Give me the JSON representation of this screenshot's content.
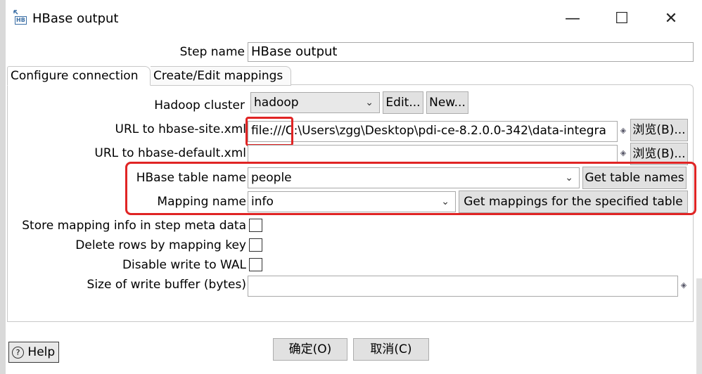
{
  "window": {
    "title": "HBase output",
    "icon_text": "HB",
    "minimize_glyph": "—",
    "maximize_glyph": "☐",
    "close_glyph": "✕"
  },
  "step": {
    "label": "Step name",
    "value": "HBase output"
  },
  "tabs": [
    {
      "label": "Configure connection",
      "active": true
    },
    {
      "label": "Create/Edit mappings",
      "active": false
    }
  ],
  "form": {
    "hadoop_cluster": {
      "label": "Hadoop cluster",
      "value": "hadoop",
      "edit_label": "Edit...",
      "new_label": "New..."
    },
    "hbase_site": {
      "label": "URL to hbase-site.xml",
      "value": "file:///C:\\Users\\zgg\\Desktop\\pdi-ce-8.2.0.0-342\\data-integra",
      "browse_label": "浏览(B)..."
    },
    "hbase_default": {
      "label": "URL to hbase-default.xml",
      "value": "",
      "browse_label": "浏览(B)..."
    },
    "table_name": {
      "label": "HBase table name",
      "value": "people",
      "button_label": "Get table names"
    },
    "mapping_name": {
      "label": "Mapping name",
      "value": "info",
      "button_label": "Get mappings for the specified table"
    },
    "store_mapping": {
      "label": "Store mapping info in step meta data",
      "checked": false
    },
    "delete_rows": {
      "label": "Delete rows by mapping key",
      "checked": false
    },
    "disable_wal": {
      "label": "Disable write to WAL",
      "checked": false
    },
    "write_buffer": {
      "label": "Size of write buffer (bytes)",
      "value": ""
    }
  },
  "footer": {
    "help_label": "Help",
    "ok_label": "确定(O)",
    "cancel_label": "取消(C)"
  },
  "icons": {
    "variable": "◈",
    "chevron": "⌄",
    "help": "?"
  },
  "colors": {
    "highlight": "#e02424",
    "button_bg": "#e1e1e1"
  }
}
